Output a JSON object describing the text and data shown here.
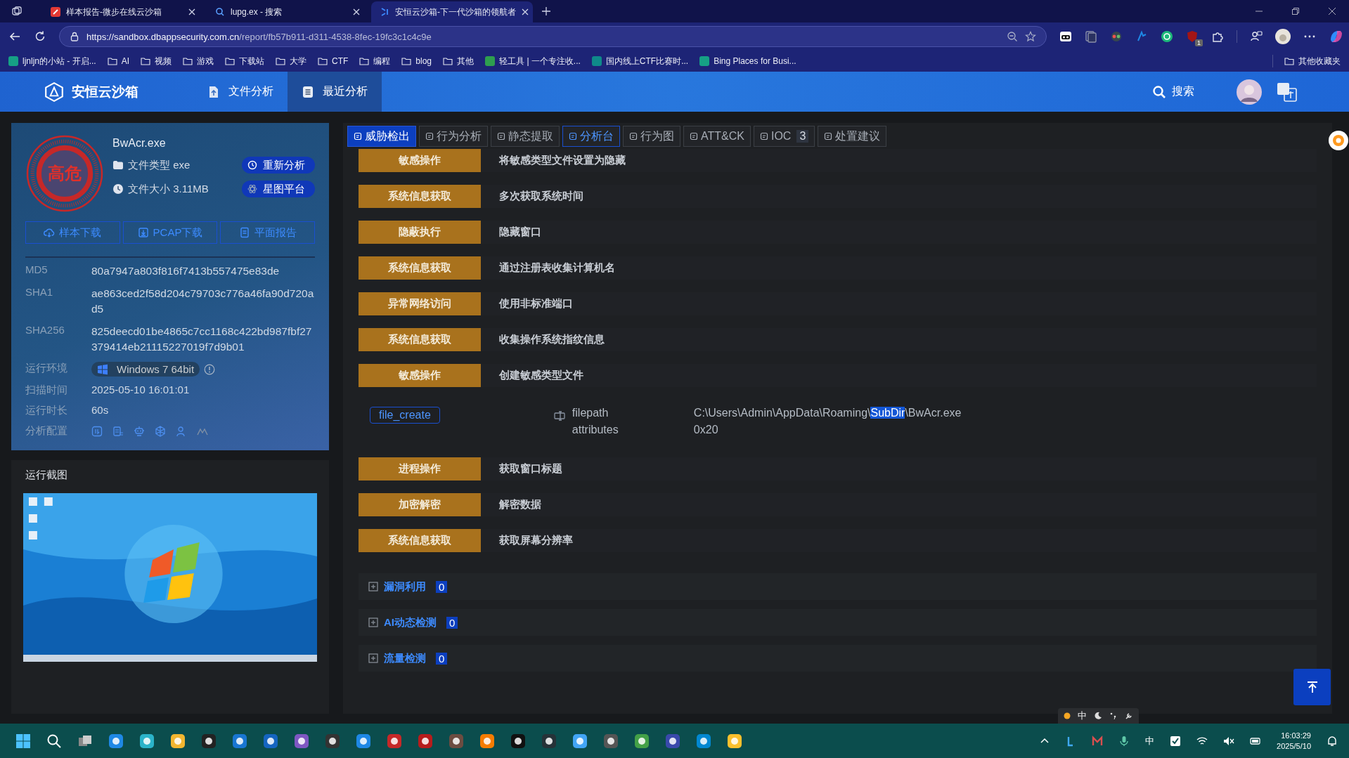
{
  "browser": {
    "tabs": [
      {
        "title": "样本报告-微步在线云沙箱",
        "selected": false,
        "kind": "red"
      },
      {
        "title": "lupg.ex - 搜索",
        "selected": false,
        "kind": "search"
      },
      {
        "title": "安恒云沙箱-下一代沙箱的领航者",
        "selected": true,
        "kind": "blue"
      }
    ],
    "url": {
      "host": "https://sandbox.dbappsecurity.com.cn",
      "path": "/report/fb57b911-d311-4538-8fec-19fc3c1c4c9e"
    },
    "bookmarks": [
      {
        "label": "ljnljn的小站 - 开启...",
        "kind": "site"
      },
      {
        "label": "AI",
        "kind": "folder"
      },
      {
        "label": "视频",
        "kind": "folder"
      },
      {
        "label": "游戏",
        "kind": "folder"
      },
      {
        "label": "下载站",
        "kind": "folder"
      },
      {
        "label": "大学",
        "kind": "folder"
      },
      {
        "label": "CTF",
        "kind": "folder"
      },
      {
        "label": "编程",
        "kind": "folder"
      },
      {
        "label": "blog",
        "kind": "folder"
      },
      {
        "label": "其他",
        "kind": "folder"
      },
      {
        "label": "轻工具 | 一个专注收...",
        "kind": "site"
      },
      {
        "label": "国内线上CTF比赛时...",
        "kind": "site"
      },
      {
        "label": "Bing Places for Busi...",
        "kind": "site"
      }
    ],
    "other_bookmarks": "其他收藏夹",
    "extension_badge": "1"
  },
  "site": {
    "brand": "安恒云沙箱",
    "nav": [
      {
        "label": "文件分析",
        "selected": false
      },
      {
        "label": "最近分析",
        "selected": true
      }
    ],
    "search": "搜索"
  },
  "sample": {
    "risk": "高危",
    "name": "BwAcr.exe",
    "file_type_label": "文件类型",
    "file_type": "exe",
    "file_size_label": "文件大小",
    "file_size": "3.11MB",
    "side_buttons": [
      "重新分析",
      "星图平台"
    ],
    "downloads": [
      "样本下载",
      "PCAP下载",
      "平面报告"
    ],
    "hashes": [
      {
        "label": "MD5",
        "value": "80a7947a803f816f7413b557475e83de"
      },
      {
        "label": "SHA1",
        "value": "ae863ced2f58d204c79703c776a46fa90d720ad5"
      },
      {
        "label": "SHA256",
        "value": "825deecd01be4865c7cc1168c422bd987fbf27379414eb21115227019f7d9b01"
      }
    ],
    "env_label": "运行环境",
    "env": "Windows 7 64bit",
    "scan_label": "扫描时间",
    "scan_time": "2025-05-10 16:01:01",
    "duration_label": "运行时长",
    "duration": "60s",
    "config_label": "分析配置"
  },
  "screenshot": {
    "title": "运行截图",
    "kind": "picture"
  },
  "report": {
    "tabs": [
      {
        "label": "威胁检出",
        "selected": true,
        "highlight": false
      },
      {
        "label": "行为分析",
        "selected": false,
        "highlight": false
      },
      {
        "label": "静态提取",
        "selected": false,
        "highlight": false
      },
      {
        "label": "分析台",
        "selected": false,
        "highlight": true
      },
      {
        "label": "行为图",
        "selected": false,
        "highlight": false
      },
      {
        "label": "ATT&CK",
        "selected": false,
        "highlight": false
      },
      {
        "label": "IOC",
        "count": "3",
        "selected": false,
        "highlight": false
      },
      {
        "label": "处置建议",
        "selected": false,
        "highlight": false
      }
    ],
    "items": [
      {
        "kind": "row",
        "category": "敏感操作",
        "description": "将敏感类型文件设置为隐藏"
      },
      {
        "kind": "row",
        "category": "系统信息获取",
        "description": "多次获取系统时间"
      },
      {
        "kind": "row",
        "category": "隐蔽执行",
        "description": "隐藏窗口"
      },
      {
        "kind": "row",
        "category": "系统信息获取",
        "description": "通过注册表收集计算机名"
      },
      {
        "kind": "row",
        "category": "异常网络访问",
        "description": "使用非标准端口"
      },
      {
        "kind": "row",
        "category": "系统信息获取",
        "description": "收集操作系统指纹信息"
      },
      {
        "kind": "row",
        "category": "敏感操作",
        "description": "创建敏感类型文件"
      },
      {
        "kind": "detail",
        "tag": "file_create",
        "fields": [
          {
            "key": "filepath",
            "value": [
              {
                "text": "C:\\Users\\Admin\\AppData\\Roaming\\",
                "selected": false
              },
              {
                "text": "SubDir",
                "selected": true
              },
              {
                "text": "\\BwAcr.exe",
                "selected": false
              }
            ]
          },
          {
            "key": "attributes",
            "value": [
              {
                "text": "0x20",
                "selected": false
              }
            ]
          }
        ]
      },
      {
        "kind": "row",
        "category": "进程操作",
        "description": "获取窗口标题"
      },
      {
        "kind": "row",
        "category": "加密解密",
        "description": "解密数据"
      },
      {
        "kind": "row",
        "category": "系统信息获取",
        "description": "获取屏幕分辨率"
      }
    ],
    "sections": [
      {
        "title": "漏洞利用",
        "count": "0",
        "expanded": false
      },
      {
        "title": "AI动态检测",
        "count": "0",
        "expanded": false
      },
      {
        "title": "流量检测",
        "count": "0",
        "expanded": false
      }
    ]
  },
  "ime_bar": "中",
  "taskbar": {
    "ime": "中",
    "time": "16:03:29",
    "date": "2025/5/10"
  }
}
